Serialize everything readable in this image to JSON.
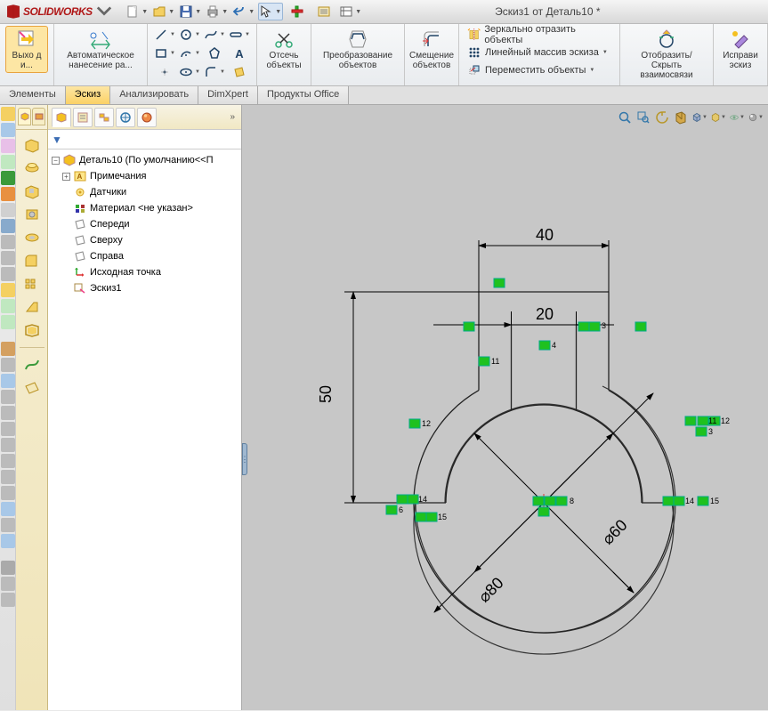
{
  "app": {
    "name": "SOLIDWORKS"
  },
  "document_title": "Эскиз1 от Деталь10 *",
  "ribbon": {
    "exit_sketch": "Выхо д и...",
    "smart_dimension": "Автоматическое нанесение ра...",
    "trim": "Отсечь объекты",
    "convert": "Преобразование объектов",
    "offset": "Смещение объектов",
    "mirror": "Зеркально отразить объекты",
    "linear_pattern": "Линейный массив эскиза",
    "move": "Переместить объекты",
    "relations": "Отобразить/Скрыть взаимосвязи",
    "repair": "Исправи эскиз"
  },
  "tabs": {
    "elements": "Элементы",
    "sketch": "Эскиз",
    "analyze": "Анализировать",
    "dimxpert": "DimXpert",
    "office": "Продукты Office"
  },
  "tree": {
    "root": "Деталь10  (По умолчанию<<П",
    "annotations": "Примечания",
    "sensors": "Датчики",
    "material": "Материал <не указан>",
    "front": "Спереди",
    "top": "Сверху",
    "right": "Справа",
    "origin": "Исходная точка",
    "sketch1": "Эскиз1"
  },
  "dimensions": {
    "d40": "40",
    "d20": "20",
    "d50": "50",
    "d60": "⌀60",
    "d80": "⌀80"
  },
  "sketch_labels": {
    "c11": "11",
    "c4": "4",
    "c3": "3",
    "c12": "12",
    "c11b": "11",
    "c12b": "12",
    "c13": "3",
    "c14": "14",
    "c15": "15",
    "c6": "6",
    "c8": "8",
    "c14b": "14",
    "c15b": "15"
  }
}
